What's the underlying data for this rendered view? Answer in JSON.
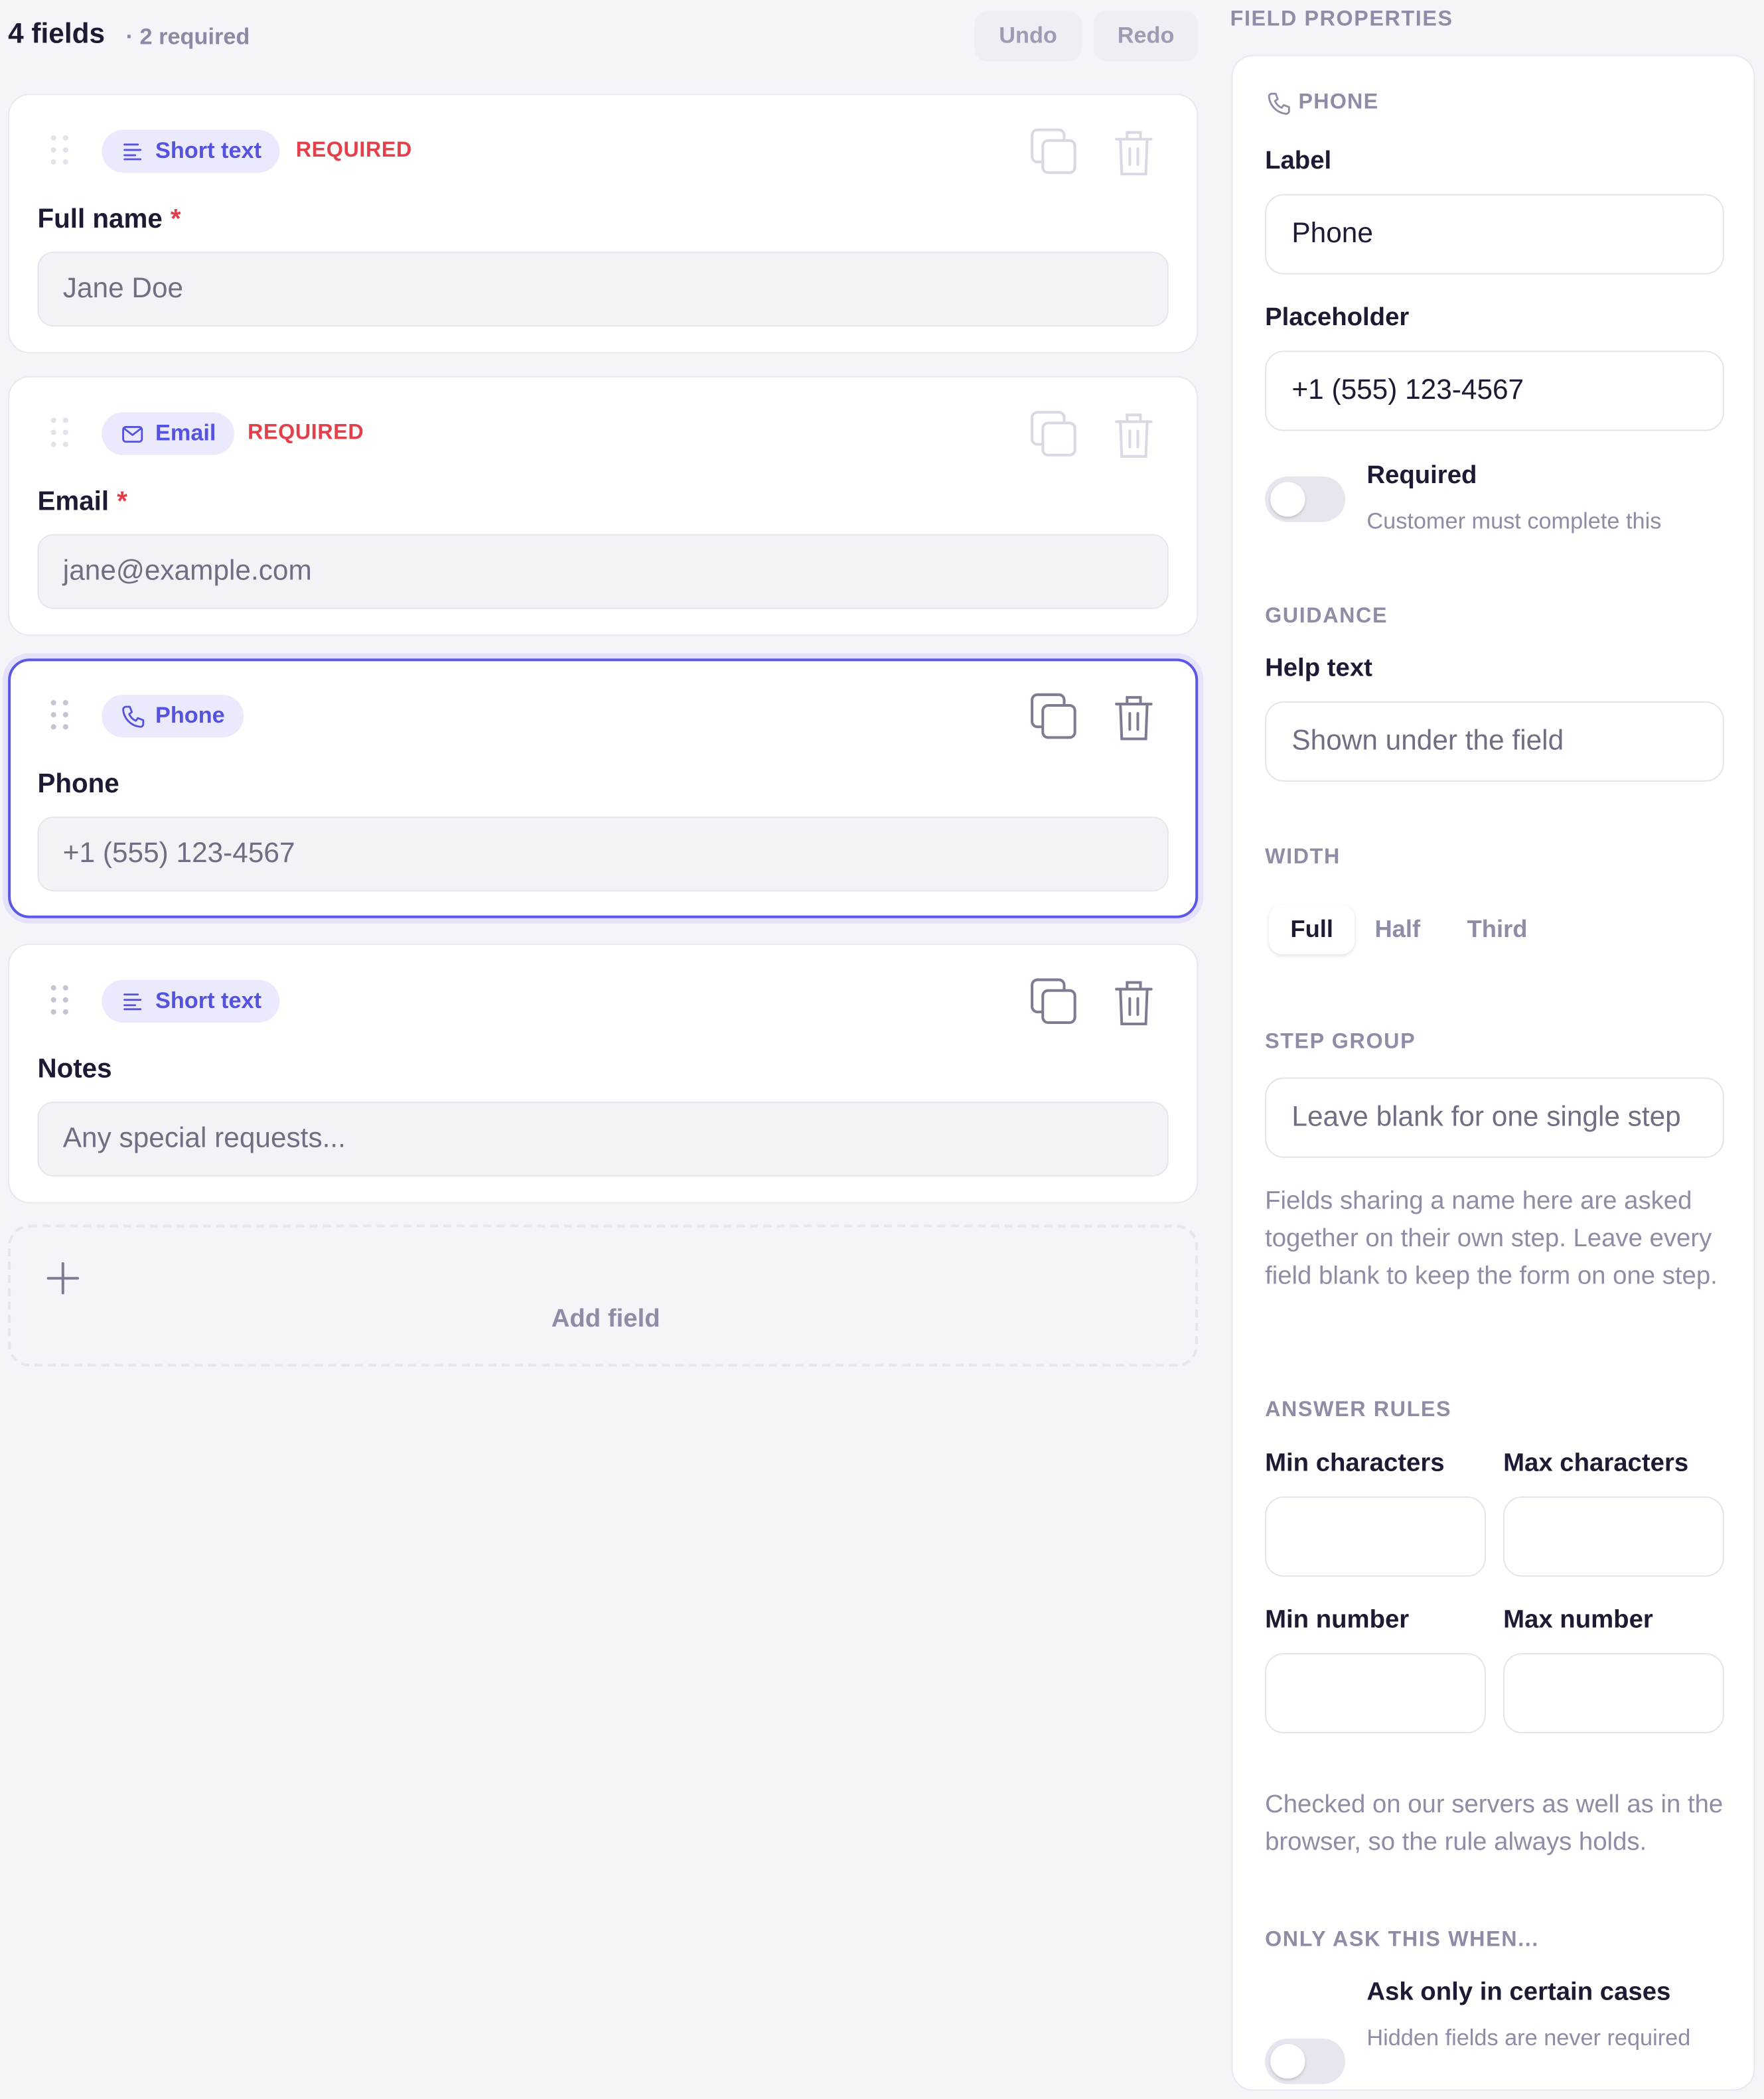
{
  "header": {
    "field_count": "4 fields",
    "required_count": "· 2 required",
    "undo_label": "Undo",
    "redo_label": "Redo"
  },
  "fields": [
    {
      "type_label": "Short text",
      "type_icon": "text-lines-icon",
      "required_tag": "REQUIRED",
      "label": "Full name",
      "star": "*",
      "placeholder": "Jane Doe"
    },
    {
      "type_label": "Email",
      "type_icon": "envelope-icon",
      "required_tag": "REQUIRED",
      "label": "Email",
      "star": "*",
      "placeholder": "jane@example.com"
    },
    {
      "type_label": "Phone",
      "type_icon": "phone-icon",
      "label": "Phone",
      "placeholder": "+1 (555) 123-4567",
      "selected": true
    },
    {
      "type_label": "Short text",
      "type_icon": "text-lines-icon",
      "label": "Notes",
      "placeholder": "Any special requests..."
    }
  ],
  "add_field_label": "Add field",
  "properties": {
    "title": "FIELD PROPERTIES",
    "type": "PHONE",
    "label_caption": "Label",
    "label_value": "Phone",
    "placeholder_caption": "Placeholder",
    "placeholder_value": "+1 (555) 123-4567",
    "required_title": "Required",
    "required_sub": "Customer must complete this",
    "required_on": false,
    "guidance_heading": "GUIDANCE",
    "help_caption": "Help text",
    "help_placeholder": "Shown under the field",
    "width_heading": "WIDTH",
    "width_options": [
      "Full",
      "Half",
      "Third"
    ],
    "width_selected": "Full",
    "step_heading": "STEP GROUP",
    "step_placeholder": "Leave blank for one single step",
    "step_help": "Fields sharing a name here are asked together on their own step. Leave every field blank to keep the form on one step.",
    "rules_heading": "ANSWER RULES",
    "min_chars": "Min characters",
    "max_chars": "Max characters",
    "min_number": "Min number",
    "max_number": "Max number",
    "rules_help": "Checked on our servers as well as in the browser, so the rule always holds.",
    "conditional_heading": "ONLY ASK THIS WHEN...",
    "conditional_title": "Ask only in certain cases",
    "conditional_sub": "Hidden fields are never required",
    "conditional_on": false
  },
  "colors": {
    "accent": "#5b58e6",
    "pill_bg": "#ebeafc",
    "required_red": "#e2404b",
    "muted": "#8d8da6",
    "background": "#f4f4f9"
  }
}
